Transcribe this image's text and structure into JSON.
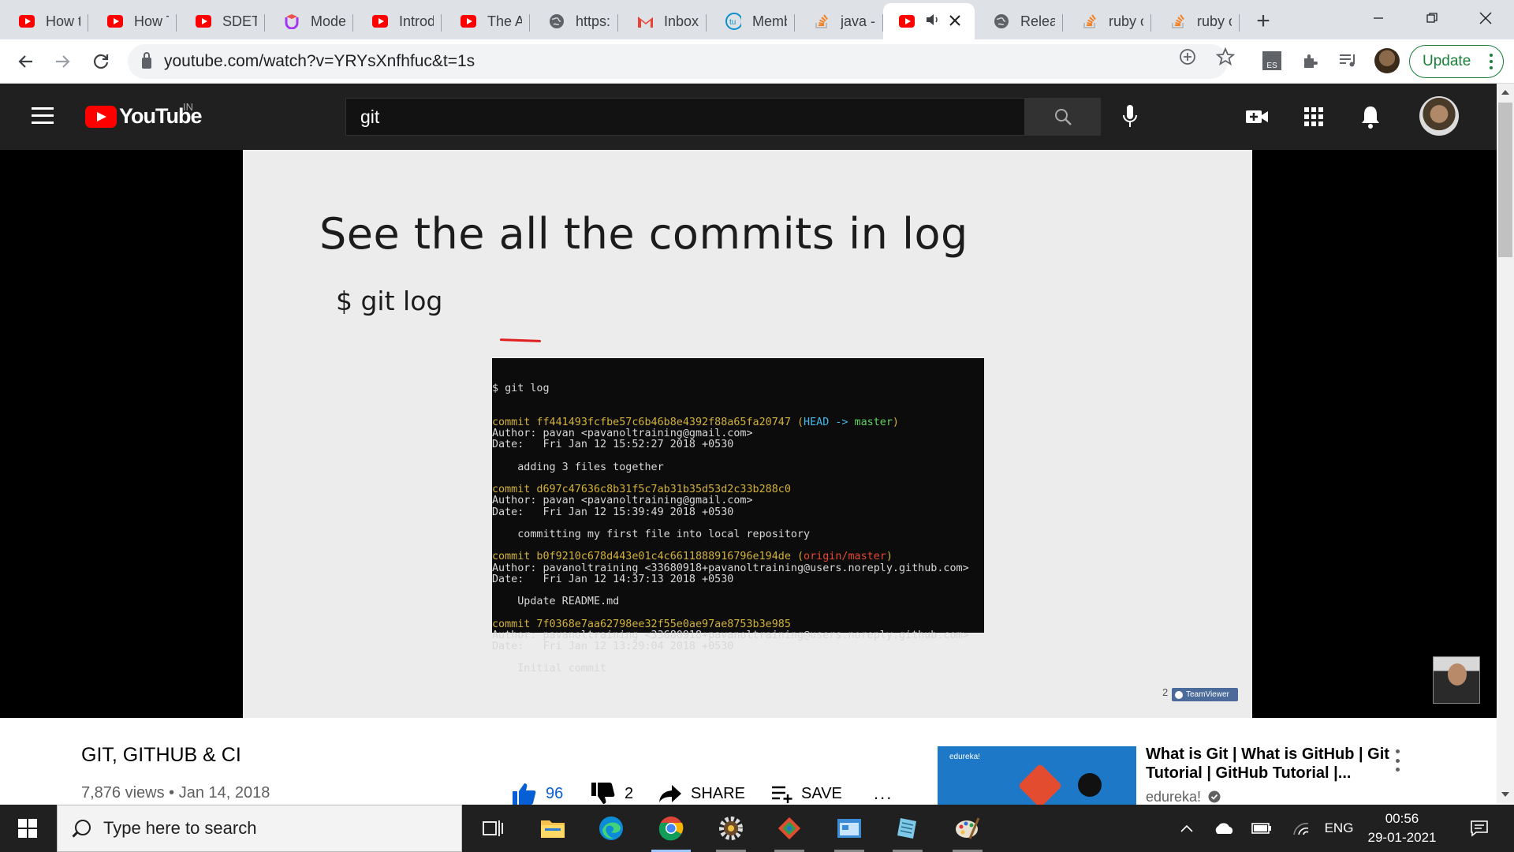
{
  "browser": {
    "tabs": [
      {
        "label": "How to",
        "icon": "youtube-icon"
      },
      {
        "label": "How T",
        "icon": "youtube-icon"
      },
      {
        "label": "SDET -",
        "icon": "youtube-icon"
      },
      {
        "label": "Moder",
        "icon": "udemy-icon"
      },
      {
        "label": "Introd",
        "icon": "youtube-icon"
      },
      {
        "label": "The Ar",
        "icon": "youtube-icon"
      },
      {
        "label": "https:/",
        "icon": "globe-icon"
      },
      {
        "label": "Inbox (",
        "icon": "gmail-icon"
      },
      {
        "label": "Memb",
        "icon": "tu-icon"
      },
      {
        "label": "java - (",
        "icon": "stackoverflow-icon"
      },
      {
        "label": "",
        "icon": "youtube-icon",
        "active": true
      },
      {
        "label": "Releas",
        "icon": "globe-icon"
      },
      {
        "label": "ruby o",
        "icon": "stackoverflow-icon"
      },
      {
        "label": "ruby o",
        "icon": "stackoverflow-icon"
      }
    ],
    "new_tab": "+",
    "url": "youtube.com/watch?v=YRYsXnfhfuc&t=1s",
    "extension_badge": "ES",
    "update_label": "Update"
  },
  "youtube": {
    "logo_text": "YouTube",
    "country_code": "IN",
    "search_query": "git",
    "colors": {
      "brand": "#ff0000",
      "header_bg": "#202020",
      "link": "#065fd4"
    }
  },
  "video": {
    "slide_title": "See the all the commits in log",
    "slide_command": "$ git log",
    "terminal": {
      "prompt": "$ git log",
      "commits": [
        {
          "hash_line": "commit ff441493fcfbe57c6b46b8e4392f88a65fa20747",
          "head": "HEAD -> ",
          "branch": "master",
          "author": "Author: pavan <pavanoltraining@gmail.com>",
          "date": "Date:   Fri Jan 12 15:52:27 2018 +0530",
          "message": "    adding 3 files together"
        },
        {
          "hash_line": "commit d697c47636c8b31f5c7ab31b35d53d2c33b288c0",
          "author": "Author: pavan <pavanoltraining@gmail.com>",
          "date": "Date:   Fri Jan 12 15:39:49 2018 +0530",
          "message": "    committing my first file into local repository"
        },
        {
          "hash_line": "commit b0f9210c678d443e01c4c6611888916796e194de",
          "remote": "origin/master",
          "author": "Author: pavanoltraining <33680918+pavanoltraining@users.noreply.github.com>",
          "date": "Date:   Fri Jan 12 14:37:13 2018 +0530",
          "message": "    Update README.md"
        },
        {
          "hash_line": "commit 7f0368e7aa62798ee32f55e0ae97ae8753b3e985",
          "author": "Author: pavanoltraining <33680918+pavanoltraining@users.noreply.github.com>",
          "date": "Date:   Fri Jan 12 13:29:04 2018 +0530",
          "message": "    Initial commit"
        }
      ]
    },
    "page_number": "2",
    "teamviewer_label": "TeamViewer",
    "title": "GIT, GITHUB & CI",
    "views_date": "7,876 views • Jan 14, 2018",
    "likes": "96",
    "dislikes": "2",
    "share_label": "SHARE",
    "save_label": "SAVE",
    "more_label": "..."
  },
  "related": {
    "thumb_brand": "edureka!",
    "title": "What is Git | What is GitHub | Git Tutorial | GitHub Tutorial |...",
    "channel": "edureka!"
  },
  "taskbar": {
    "search_placeholder": "Type here to search",
    "language": "ENG",
    "time": "00:56",
    "date": "29-01-2021"
  }
}
